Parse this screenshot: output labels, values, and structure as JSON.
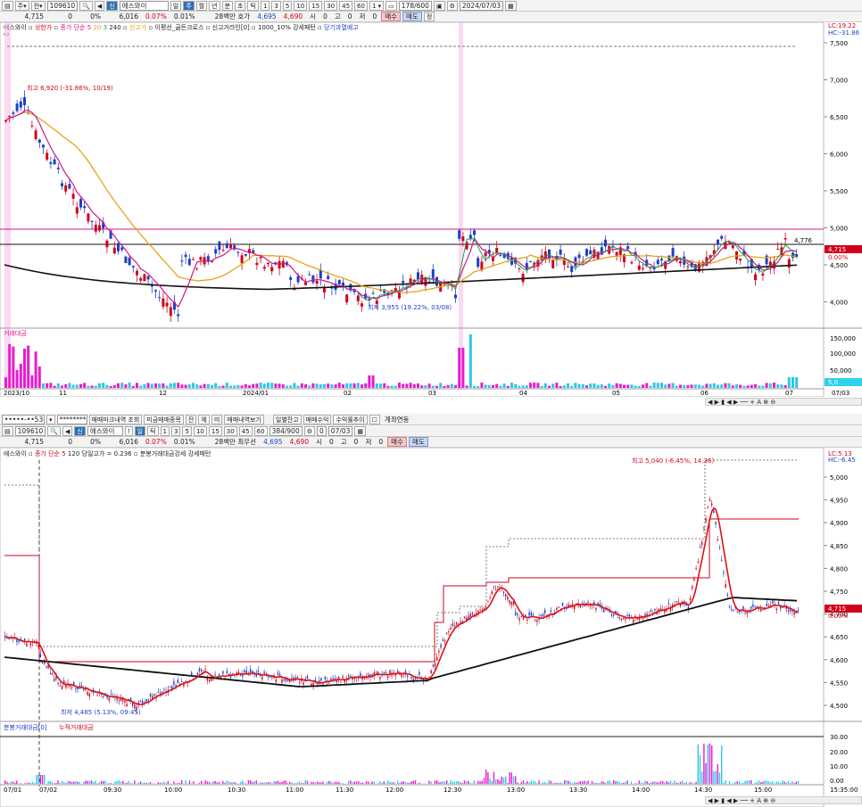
{
  "top": {
    "toolbar": {
      "code": "109610",
      "name": "에스와이",
      "periods": [
        "일",
        "주",
        "월",
        "년",
        "분",
        "초",
        "틱"
      ],
      "nums": [
        "1",
        "3",
        "5",
        "10",
        "15",
        "30",
        "45",
        "60"
      ],
      "count": "178/600",
      "date": "2024/07/03"
    },
    "quote": {
      "price": "4,715",
      "change": "0",
      "change_pct": "0%",
      "volume": "6,016",
      "vol_pct": "0.07%",
      "vol_pct2": "0.01%",
      "ask_label": "28백만 호가",
      "ask": "4,695",
      "bid": "4,690",
      "open_label": "시",
      "open": "0",
      "high_label": "고",
      "high": "0",
      "low_label": "저",
      "low": "0",
      "buy": "매수",
      "sell": "매도",
      "extra": "정"
    },
    "legend": {
      "name": "에스와이",
      "ma_label": "종가 단순",
      "ma_vals": [
        "5",
        "20",
        "3",
        "240"
      ],
      "items": [
        "상한가",
        "신고가",
        "이평선_골든크로스",
        "신고거라인[0]",
        "1000_10% 강세패턴",
        "당기과열예고"
      ]
    },
    "right_axis": {
      "lc": "LC:19.22",
      "hc": "HC:-31.86"
    },
    "price_labels": [
      "7,500",
      "7,000",
      "6,500",
      "6,000",
      "5,500",
      "5,000",
      "4,500",
      "4,000"
    ],
    "annotations": {
      "high": "최고 6,920 (-31.86%, 10/19)",
      "low": "최저 3,955 (19.22%, 03/08)",
      "line_value": "4,776",
      "current": "4,715",
      "current2": "0.00%"
    },
    "volume": {
      "label": "거래대금",
      "axis": [
        "150,000",
        "100,000",
        "50,000"
      ],
      "last_value": "5,0"
    },
    "x_labels": [
      "2023/10",
      "11",
      "12",
      "2024/01",
      "02",
      "03",
      "04",
      "05",
      "06",
      "07"
    ],
    "x_end": "07/03"
  },
  "mid": {
    "toolbar1": {
      "account": "•••••-••53",
      "password": "********",
      "buttons": [
        "매매마크내역 조회",
        "미금매매종목",
        "잔",
        "체",
        "미",
        "매매내역보기",
        "일별잔고",
        "매매수익",
        "수익률추이"
      ],
      "option": "계좌연동"
    },
    "toolbar2": {
      "code": "109610",
      "name": "에스와이",
      "periods": [
        "일",
        "틱"
      ],
      "nums": [
        "1",
        "3",
        "5",
        "10",
        "15",
        "30",
        "45",
        "60"
      ],
      "count": "384/900",
      "num2": "0",
      "date": "07/03"
    },
    "quote": {
      "price": "4,715",
      "change": "0",
      "change_pct": "0%",
      "volume": "6,016",
      "vol_pct": "0.07%",
      "vol_pct2": "0.01%",
      "ask_label": "28백만 최우선",
      "ask": "4,695",
      "bid": "4,690",
      "open_label": "시",
      "open": "0",
      "high_label": "고",
      "high": "0",
      "low_label": "저",
      "low": "0",
      "buy": "매수",
      "sell": "매도"
    }
  },
  "bottom": {
    "legend": {
      "name": "에스와이",
      "ma_label": "종가 단순",
      "ma_vals": [
        "5",
        "120"
      ],
      "extra": "당일고가 = 0.236",
      "pattern": "분봉거래대금강세 강세패턴"
    },
    "right_axis": {
      "lc": "LC:5.13",
      "hc": "HC:-6.45"
    },
    "price_labels": [
      "5,000",
      "4,950",
      "4,900",
      "4,850",
      "4,800",
      "4,750",
      "4,700",
      "4,650",
      "4,600",
      "4,550",
      "4,500"
    ],
    "annotations": {
      "high": "최고 5,040 (-6.45%, 14:36)",
      "low": "최저 4,485 (5.13%, 09:45)",
      "current": "4,715",
      "current2": "0.00%"
    },
    "volume": {
      "label": "분봉거래대금[0]",
      "label2": "누적거래대금",
      "axis": [
        "30.00",
        "20.00",
        "10.00",
        "0.00"
      ]
    },
    "x_labels": [
      "07/01",
      "07/02",
      "09:30",
      "10:00",
      "10:30",
      "11:00",
      "11:30",
      "12:00",
      "12:30",
      "13:00",
      "13:30",
      "14:00",
      "14:30",
      "15:00"
    ],
    "x_end": "15:35:00"
  },
  "colors": {
    "up": "#d0021b",
    "down": "#1c3fc9",
    "ma5": "#d4148a",
    "ma20": "#e6a317",
    "ma240": "#111111",
    "green": "#1aa34a"
  }
}
